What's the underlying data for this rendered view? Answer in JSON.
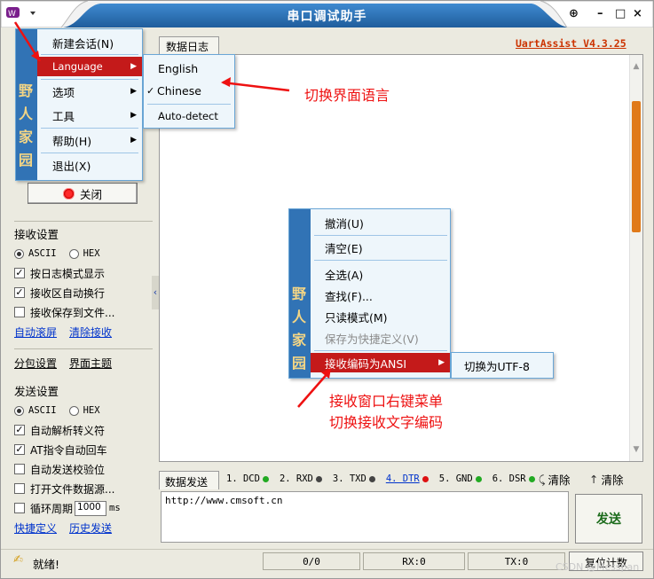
{
  "window": {
    "title": "串口调试助手",
    "version": "UartAssist V4.3.25"
  },
  "titlebar_buttons": {
    "pin": "⊕",
    "min": "–",
    "max": "□",
    "close": "×"
  },
  "tabs": {
    "log": "数据日志",
    "send": "数据发送"
  },
  "main_menu": {
    "items": [
      {
        "label": "新建会话(N)",
        "arrow": ""
      },
      {
        "label": "Language",
        "arrow": "▶"
      },
      {
        "label": "选项",
        "arrow": "▶"
      },
      {
        "label": "工具",
        "arrow": "▶"
      },
      {
        "label": "帮助(H)",
        "arrow": "▶"
      },
      {
        "label": "退出(X)",
        "arrow": ""
      }
    ],
    "strip_text": [
      "野",
      "人",
      "家",
      "园"
    ]
  },
  "language_menu": {
    "items": [
      {
        "label": "English"
      },
      {
        "label": "Chinese",
        "check": "✓"
      },
      {
        "label": "Auto-detect"
      }
    ]
  },
  "context_menu": {
    "items": [
      {
        "label": "撤消(U)"
      },
      {
        "label": "清空(E)"
      },
      {
        "label": "全选(A)"
      },
      {
        "label": "查找(F)..."
      },
      {
        "label": "只读模式(M)"
      },
      {
        "label": "保存为快捷定义(V)"
      },
      {
        "label": "接收编码为ANSI",
        "arrow": "▶"
      }
    ],
    "strip_text": [
      "野",
      "人",
      "家",
      "园"
    ],
    "submenu_label": "切换为UTF-8"
  },
  "annotations": {
    "language": "切换界面语言",
    "context_line1": "接收窗口右键菜单",
    "context_line2": "切换接收文字编码"
  },
  "close_button": "关闭",
  "recv_settings": {
    "title": "接收设置",
    "ascii": "ASCII",
    "hex": "HEX",
    "options": [
      {
        "label": "按日志模式显示",
        "checked": true
      },
      {
        "label": "接收区自动换行",
        "checked": true
      },
      {
        "label": "接收保存到文件...",
        "checked": false
      }
    ],
    "links": [
      "自动滚屏",
      "清除接收"
    ]
  },
  "mid_links": [
    "分包设置",
    "界面主题"
  ],
  "send_settings": {
    "title": "发送设置",
    "ascii": "ASCII",
    "hex": "HEX",
    "options": [
      {
        "label": "自动解析转义符",
        "checked": true
      },
      {
        "label": "AT指令自动回车",
        "checked": true
      },
      {
        "label": "自动发送校验位",
        "checked": false
      },
      {
        "label": "打开文件数据源...",
        "checked": false
      },
      {
        "label": "循环周期",
        "checked": false
      }
    ],
    "period_value": "1000",
    "period_unit": "ms",
    "links": [
      "快捷定义",
      "历史发送"
    ]
  },
  "signals": [
    {
      "label": "1. DCD",
      "color": "#22aa22"
    },
    {
      "label": "2. RXD",
      "color": "#444444"
    },
    {
      "label": "3. TXD",
      "color": "#444444"
    },
    {
      "label": "4. DTR",
      "color": "#dd1111"
    },
    {
      "label": "5. GND",
      "color": "#22aa22"
    },
    {
      "label": "6. DSR",
      "color": "#22aa22"
    }
  ],
  "clear_labels": [
    "清除",
    "清除"
  ],
  "send_input_value": "http://www.cmsoft.cn",
  "send_button": "发送",
  "status": {
    "ready": "就绪!",
    "count": "0/0",
    "rx": "RX:0",
    "tx": "TX:0",
    "reset": "复位计数"
  },
  "watermark": "CSDN @Messpan",
  "colors": {
    "accent": "#3173b5",
    "menu_selected": "#c41a1a",
    "annotation": "#ee1111",
    "version": "#cc3300"
  }
}
